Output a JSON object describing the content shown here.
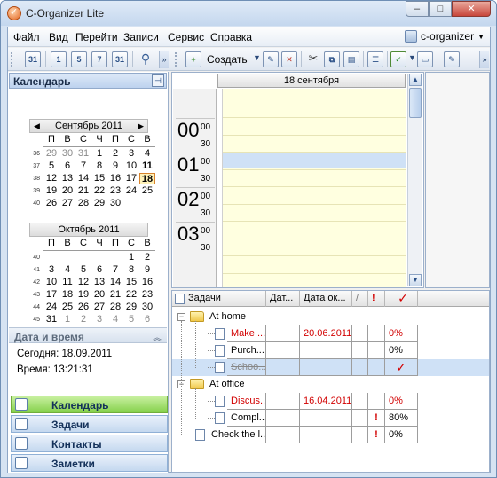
{
  "window": {
    "title": "C-Organizer Lite"
  },
  "menu": {
    "items": [
      "Файл",
      "Вид",
      "Перейти",
      "Записи",
      "Сервис",
      "Справка"
    ],
    "user": "c-organizer"
  },
  "toolbar": {
    "create_label": "Создать"
  },
  "calendar_panel": {
    "title": "Календарь",
    "day_names": [
      "П",
      "В",
      "С",
      "Ч",
      "П",
      "С",
      "В"
    ],
    "months": [
      {
        "title": "Сентябрь 2011",
        "weeks": [
          {
            "num": "36",
            "days": [
              "29",
              "30",
              "31",
              "1",
              "2",
              "3",
              "4"
            ]
          },
          {
            "num": "37",
            "days": [
              "5",
              "6",
              "7",
              "8",
              "9",
              "10",
              "11"
            ]
          },
          {
            "num": "38",
            "days": [
              "12",
              "13",
              "14",
              "15",
              "16",
              "17",
              "18"
            ]
          },
          {
            "num": "39",
            "days": [
              "19",
              "20",
              "21",
              "22",
              "23",
              "24",
              "25"
            ]
          },
          {
            "num": "40",
            "days": [
              "26",
              "27",
              "28",
              "29",
              "30",
              "",
              ""
            ]
          }
        ]
      },
      {
        "title": "Октябрь 2011",
        "weeks": [
          {
            "num": "40",
            "days": [
              "",
              "",
              "",
              "",
              "",
              "1",
              "2"
            ]
          },
          {
            "num": "41",
            "days": [
              "3",
              "4",
              "5",
              "6",
              "7",
              "8",
              "9"
            ]
          },
          {
            "num": "42",
            "days": [
              "10",
              "11",
              "12",
              "13",
              "14",
              "15",
              "16"
            ]
          },
          {
            "num": "43",
            "days": [
              "17",
              "18",
              "19",
              "20",
              "21",
              "22",
              "23"
            ]
          },
          {
            "num": "44",
            "days": [
              "24",
              "25",
              "26",
              "27",
              "28",
              "29",
              "30"
            ]
          },
          {
            "num": "45",
            "days": [
              "31",
              "1",
              "2",
              "3",
              "4",
              "5",
              "6"
            ]
          }
        ]
      }
    ]
  },
  "datetime_panel": {
    "title": "Дата и время",
    "today": "Сегодня: 18.09.2011",
    "time": "Время: 13:21:31"
  },
  "nav_buttons": [
    "Календарь",
    "Задачи",
    "Контакты",
    "Заметки"
  ],
  "day_view": {
    "header": "18 сентября",
    "hours": [
      {
        "hour": "00",
        "min_top": "00",
        "min_bottom": "30"
      },
      {
        "hour": "01",
        "min_top": "00",
        "min_bottom": "30"
      },
      {
        "hour": "02",
        "min_top": "00",
        "min_bottom": "30"
      },
      {
        "hour": "03",
        "min_top": "00",
        "min_bottom": "30"
      }
    ]
  },
  "tasks": {
    "columns": [
      "Задачи",
      "Дат...",
      "Дата ок...",
      "/",
      "!",
      "✓"
    ],
    "groups": [
      {
        "name": "At home",
        "items": [
          {
            "title": "Make ...",
            "due": "20.06.2011",
            "progress": "0%",
            "priority": "",
            "done": "",
            "overdue": true
          },
          {
            "title": "Purch...",
            "due": "",
            "progress": "0%",
            "priority": "",
            "done": "",
            "overdue": false
          },
          {
            "title": "Schoo...",
            "due": "",
            "progress": "",
            "priority": "",
            "done": "✓",
            "overdue": false,
            "completed": true
          }
        ]
      },
      {
        "name": "At office",
        "items": [
          {
            "title": "Discus...",
            "due": "16.04.2011",
            "progress": "0%",
            "priority": "",
            "done": "",
            "overdue": true
          },
          {
            "title": "Compl...",
            "due": "",
            "progress": "80%",
            "priority": "!",
            "done": "",
            "overdue": false
          }
        ]
      }
    ],
    "standalone": [
      {
        "title": "Check the l...",
        "due": "",
        "progress": "0%",
        "priority": "!",
        "done": ""
      }
    ]
  }
}
